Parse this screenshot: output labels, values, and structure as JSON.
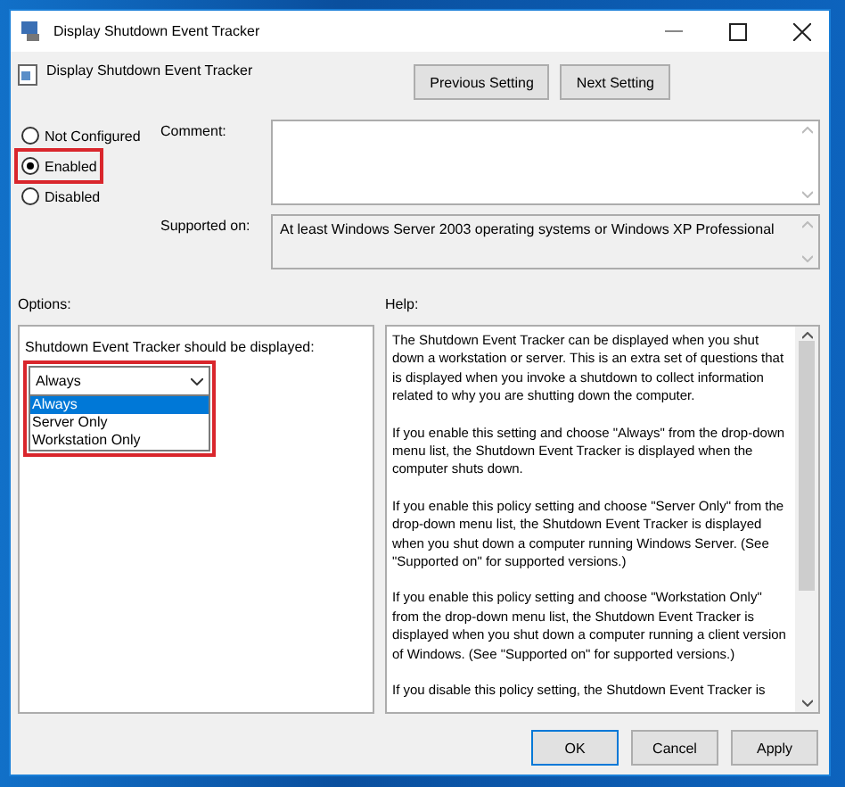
{
  "window": {
    "title": "Display Shutdown Event Tracker"
  },
  "header": {
    "title": "Display Shutdown Event Tracker",
    "buttons": [
      "Previous Setting",
      "Next Setting"
    ]
  },
  "radios": [
    {
      "label": "Not Configured",
      "selected": false,
      "highlighted": false
    },
    {
      "label": "Enabled",
      "selected": true,
      "highlighted": true
    },
    {
      "label": "Disabled",
      "selected": false,
      "highlighted": false
    }
  ],
  "comment": {
    "label": "Comment:"
  },
  "supported_on": {
    "label": "Supported on:",
    "value": "At least Windows Server 2003 operating systems or Windows XP Professional"
  },
  "options": {
    "label": "Options:",
    "field_label": "Shutdown Event Tracker should be displayed:",
    "dropdown": {
      "value": "Always",
      "expanded": true,
      "highlighted": true,
      "items": [
        {
          "label": "Always",
          "selected": true
        },
        {
          "label": "Server Only",
          "selected": false
        },
        {
          "label": "Workstation Only",
          "selected": false
        }
      ]
    }
  },
  "help": {
    "label": "Help:",
    "paragraphs": [
      "The Shutdown Event Tracker can be displayed when you shut down a workstation or server.  This is an extra set of questions that is displayed when you invoke a shutdown to collect information related to why you are shutting down the computer.",
      "If you enable this setting and choose \"Always\" from the drop-down menu list, the Shutdown Event Tracker is displayed when the computer shuts down.",
      "If you enable this policy setting and choose \"Server Only\" from the drop-down menu list, the Shutdown Event Tracker is displayed when you shut down a computer running Windows Server. (See \"Supported on\" for supported versions.)",
      "If you enable this policy setting and choose \"Workstation Only\" from the drop-down menu list, the Shutdown Event Tracker is displayed when you shut down a computer running a client version of Windows. (See \"Supported on\" for supported versions.)",
      "If you disable this policy setting, the Shutdown Event Tracker is"
    ]
  },
  "buttons": [
    "OK",
    "Cancel",
    "Apply"
  ]
}
